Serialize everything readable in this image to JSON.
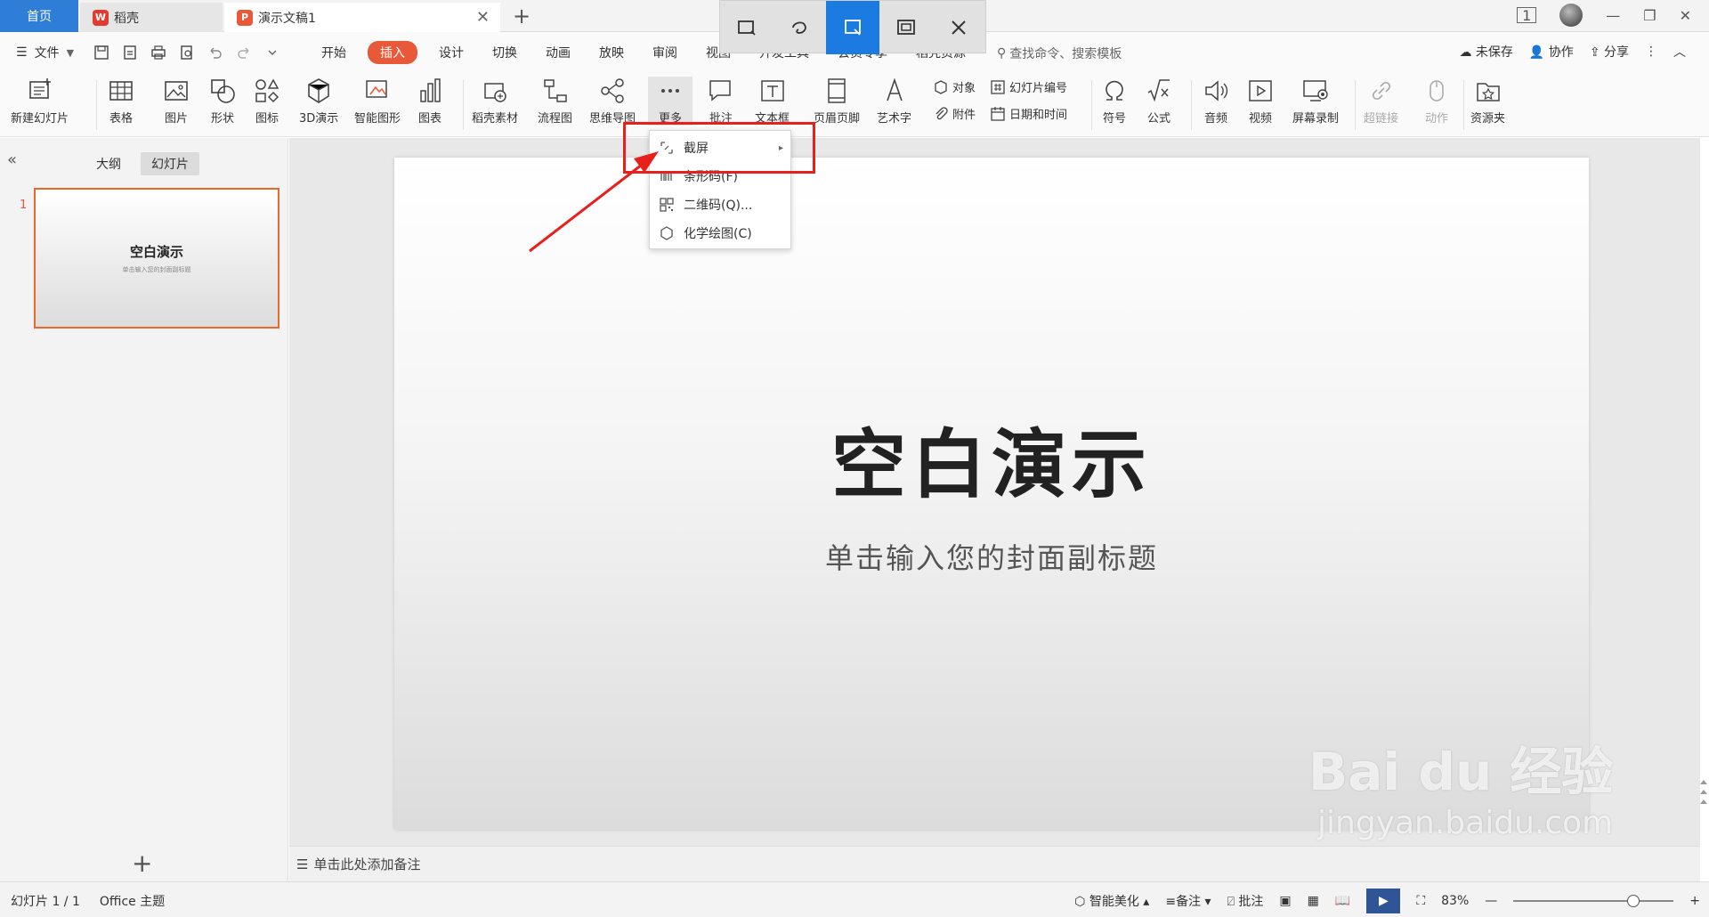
{
  "tabs": {
    "home": "首页",
    "daoke": "稻壳",
    "doc": "演示文稿1",
    "logo_doc": "P",
    "logo_dk": "W"
  },
  "window": {
    "badge": "1"
  },
  "menubar": {
    "file": "文件",
    "tabs": [
      "开始",
      "插入",
      "设计",
      "切换",
      "动画",
      "放映",
      "审阅",
      "视图",
      "开发工具",
      "会员专享",
      "稻壳资源"
    ],
    "search": "查找命令、搜索模板",
    "unsaved": "未保存",
    "collab": "协作",
    "share": "分享"
  },
  "ribbon": {
    "new_slide": "新建幻灯片",
    "table": "表格",
    "picture": "图片",
    "shape": "形状",
    "icon": "图标",
    "threed": "3D演示",
    "smart": "智能图形",
    "chart": "图表",
    "daoke_material": "稻壳素材",
    "flowchart": "流程图",
    "mindmap": "思维导图",
    "more": "更多",
    "comment": "批注",
    "textbox": "文本框",
    "header_footer": "页眉页脚",
    "wordart": "艺术字",
    "object": "对象",
    "slide_number": "幻灯片编号",
    "attachment": "附件",
    "datetime": "日期和时间",
    "symbol": "符号",
    "formula": "公式",
    "audio": "音频",
    "video": "视频",
    "screen_record": "屏幕录制",
    "hyperlink": "超链接",
    "action": "动作",
    "resource": "资源夹"
  },
  "dropdown": {
    "items": [
      "截屏",
      "条形码(F)",
      "二维码(Q)...",
      "化学绘图(C)"
    ]
  },
  "leftpanel": {
    "outline": "大纲",
    "slides": "幻灯片",
    "slide_index": "1",
    "thumb_title": "空白演示",
    "thumb_sub": "单击输入您的封面副标题"
  },
  "slide": {
    "title": "空白演示",
    "subtitle": "单击输入您的封面副标题"
  },
  "notes": {
    "placeholder": "单击此处添加备注"
  },
  "statusbar": {
    "slide_count": "幻灯片 1 / 1",
    "theme": "Office 主题",
    "beautify": "智能美化",
    "notes": "备注",
    "comment": "批注",
    "zoom": "83%"
  },
  "watermark": {
    "line1": "Bai du 经验",
    "line2": "jingyan.baidu.com"
  },
  "colors": {
    "accent": "#e8593a",
    "home_tab": "#2e7dd7",
    "annotation": "#e8201c",
    "snap_active": "#1b7be0"
  }
}
